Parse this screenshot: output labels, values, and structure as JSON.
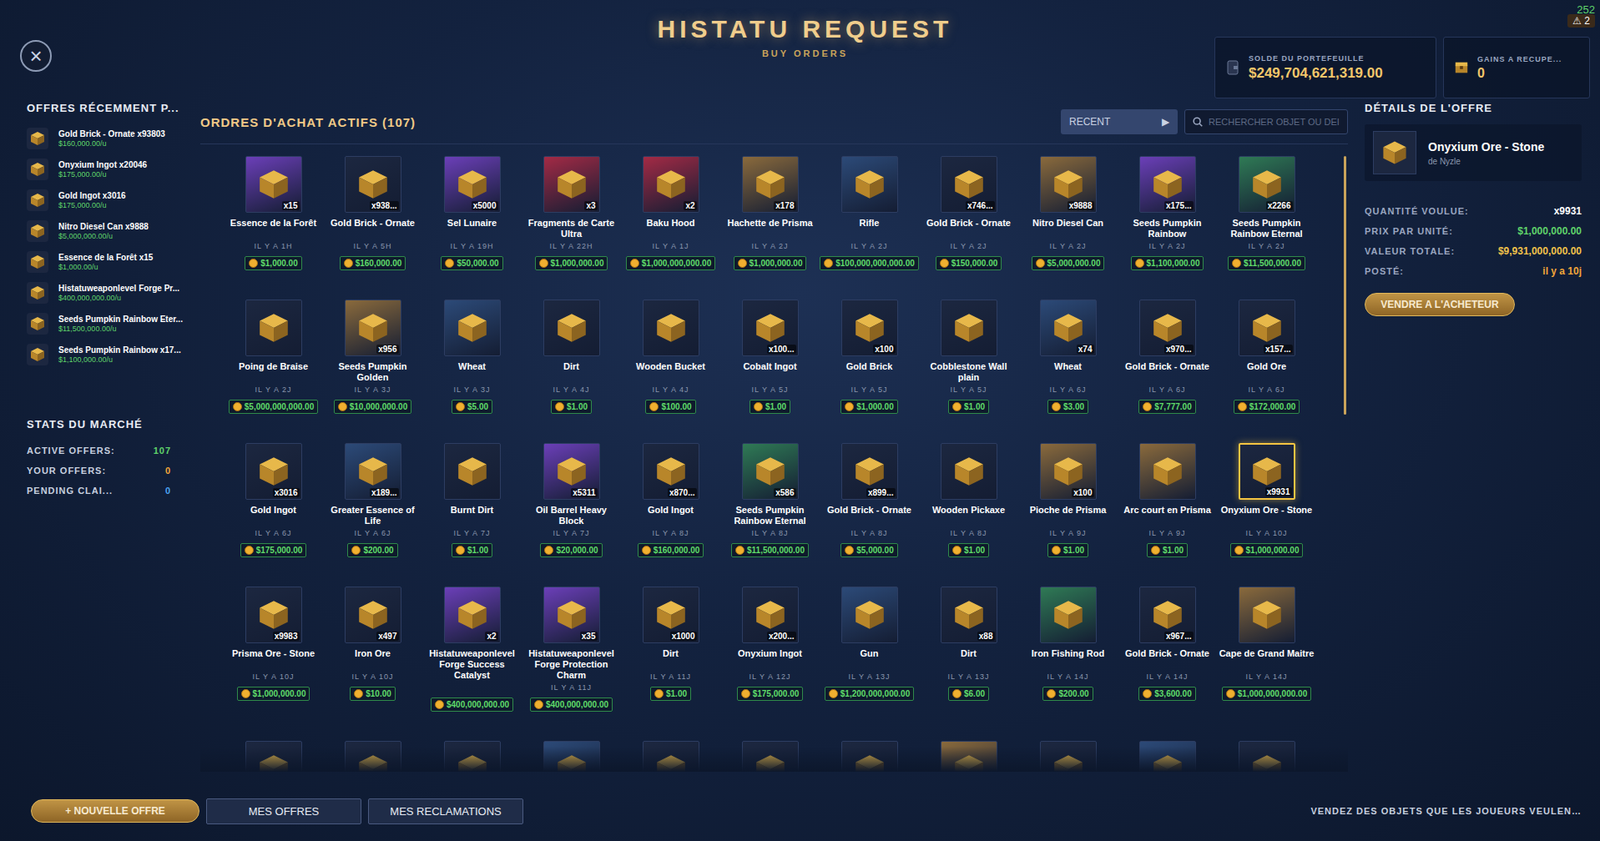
{
  "header": {
    "title": "HISTATU REQUEST",
    "subtitle": "BUY ORDERS",
    "close": "×"
  },
  "wallet": {
    "label": "SOLDE DU PORTEFEUILLE",
    "value": "$249,704,621,319.00"
  },
  "earnings": {
    "label": "GAINS A RECUPE...",
    "value": "0"
  },
  "corner": {
    "counter": "252",
    "alert_icon": "⚠",
    "alert_count": "2"
  },
  "sidebar": {
    "recent_title": "OFFRES RÉCEMMENT P...",
    "recent": [
      {
        "name": "Gold Brick - Ornate x93803",
        "price": "$160,000.00/u"
      },
      {
        "name": "Onyxium Ingot x20046",
        "price": "$175,000.00/u"
      },
      {
        "name": "Gold Ingot x3016",
        "price": "$175,000.00/u"
      },
      {
        "name": "Nitro Diesel Can x9888",
        "price": "$5,000,000.00/u"
      },
      {
        "name": "Essence de la Forêt x15",
        "price": "$1,000.00/u"
      },
      {
        "name": "Histatuweaponlevel Forge Pr...",
        "price": "$400,000,000.00/u"
      },
      {
        "name": "Seeds Pumpkin Rainbow Eter...",
        "price": "$11,500,000.00/u"
      },
      {
        "name": "Seeds Pumpkin Rainbow x17...",
        "price": "$1,100,000.00/u"
      }
    ],
    "stats_title": "STATS DU MARCHÉ",
    "stats": [
      {
        "label": "ACTIVE OFFERS:",
        "value": "107",
        "color": "#5fd36a"
      },
      {
        "label": "YOUR OFFERS:",
        "value": "0",
        "color": "#f0a53a"
      },
      {
        "label": "PENDING CLAI...",
        "value": "0",
        "color": "#4aa3f0"
      }
    ]
  },
  "main": {
    "title": "ORDRES D'ACHAT ACTIFS (107)",
    "sort": {
      "label": "RECENT",
      "icon": "▶"
    },
    "search": {
      "placeholder": "RECHERCHER OBJET OU DEI"
    },
    "cards": [
      {
        "name": "Essence de la Forêt",
        "qty": "x15",
        "time": "IL Y A 1H",
        "price": "$1,000.00",
        "color": "#6b3fb8",
        "selected": false
      },
      {
        "name": "Gold Brick - Ornate",
        "qty": "x938...",
        "time": "IL Y A 5H",
        "price": "$160,000.00",
        "color": "#1c2740",
        "selected": false
      },
      {
        "name": "Sel Lunaire",
        "qty": "x5000",
        "time": "IL Y A 19H",
        "price": "$50,000.00",
        "color": "#6b3fb8",
        "selected": false
      },
      {
        "name": "Fragments de Carte Ultra",
        "qty": "x3",
        "time": "IL Y A 22H",
        "price": "$1,000,000.00",
        "color": "#a32a45",
        "selected": false
      },
      {
        "name": "Baku Hood",
        "qty": "x2",
        "time": "IL Y A 1J",
        "price": "$1,000,000,000.00",
        "color": "#a32a45",
        "selected": false
      },
      {
        "name": "Hachette de Prisma",
        "qty": "x178",
        "time": "IL Y A 2J",
        "price": "$1,000,000.00",
        "color": "#8a6a3c",
        "selected": false
      },
      {
        "name": "Rifle",
        "qty": "",
        "time": "IL Y A 2J",
        "price": "$100,000,000,000.00",
        "color": "#2c4a78",
        "selected": false
      },
      {
        "name": "Gold Brick - Ornate",
        "qty": "x746...",
        "time": "IL Y A 2J",
        "price": "$150,000.00",
        "color": "#1c2740",
        "selected": false
      },
      {
        "name": "Nitro Diesel Can",
        "qty": "x9888",
        "time": "IL Y A 2J",
        "price": "$5,000,000.00",
        "color": "#8a6a3c",
        "selected": false
      },
      {
        "name": "Seeds Pumpkin Rainbow",
        "qty": "x175...",
        "time": "IL Y A 2J",
        "price": "$1,100,000.00",
        "color": "#6b3fb8",
        "selected": false
      },
      {
        "name": "Seeds Pumpkin Rainbow Eternal",
        "qty": "x2266",
        "time": "IL Y A 2J",
        "price": "$11,500,000.00",
        "color": "#2f7a55",
        "selected": false
      },
      {
        "name": "Poing de Braise",
        "qty": "",
        "time": "IL Y A 2J",
        "price": "$5,000,000,000.00",
        "color": "#1c2740",
        "selected": false
      },
      {
        "name": "Seeds Pumpkin Golden",
        "qty": "x956",
        "time": "IL Y A 3J",
        "price": "$10,000,000.00",
        "color": "#8a6a3c",
        "selected": false
      },
      {
        "name": "Wheat",
        "qty": "",
        "time": "IL Y A 3J",
        "price": "$5.00",
        "color": "#2c4a78",
        "selected": false
      },
      {
        "name": "Dirt",
        "qty": "",
        "time": "IL Y A 4J",
        "price": "$1.00",
        "color": "#1c2740",
        "selected": false
      },
      {
        "name": "Wooden Bucket",
        "qty": "",
        "time": "IL Y A 4J",
        "price": "$100.00",
        "color": "#1c2740",
        "selected": false
      },
      {
        "name": "Cobalt Ingot",
        "qty": "x100...",
        "time": "IL Y A 5J",
        "price": "$1.00",
        "color": "#1c2740",
        "selected": false
      },
      {
        "name": "Gold Brick",
        "qty": "x100",
        "time": "IL Y A 5J",
        "price": "$1,000.00",
        "color": "#1c2740",
        "selected": false
      },
      {
        "name": "Cobblestone Wall plain",
        "qty": "",
        "time": "IL Y A 5J",
        "price": "$1.00",
        "color": "#1c2740",
        "selected": false
      },
      {
        "name": "Wheat",
        "qty": "x74",
        "time": "IL Y A 6J",
        "price": "$3.00",
        "color": "#2c4a78",
        "selected": false
      },
      {
        "name": "Gold Brick - Ornate",
        "qty": "x970...",
        "time": "IL Y A 6J",
        "price": "$7,777.00",
        "color": "#1c2740",
        "selected": false
      },
      {
        "name": "Gold Ore",
        "qty": "x157...",
        "time": "IL Y A 6J",
        "price": "$172,000.00",
        "color": "#1c2740",
        "selected": false
      },
      {
        "name": "Gold Ingot",
        "qty": "x3016",
        "time": "IL Y A 6J",
        "price": "$175,000.00",
        "color": "#1c2740",
        "selected": false
      },
      {
        "name": "Greater Essence of Life",
        "qty": "x189...",
        "time": "IL Y A 6J",
        "price": "$200.00",
        "color": "#2c4a78",
        "selected": false
      },
      {
        "name": "Burnt Dirt",
        "qty": "",
        "time": "IL Y A 7J",
        "price": "$1.00",
        "color": "#1c2740",
        "selected": false
      },
      {
        "name": "Oil Barrel Heavy Block",
        "qty": "x5311",
        "time": "IL Y A 7J",
        "price": "$20,000.00",
        "color": "#6b3fb8",
        "selected": false
      },
      {
        "name": "Gold Ingot",
        "qty": "x870...",
        "time": "IL Y A 8J",
        "price": "$160,000.00",
        "color": "#1c2740",
        "selected": false
      },
      {
        "name": "Seeds Pumpkin Rainbow Eternal",
        "qty": "x586",
        "time": "IL Y A 8J",
        "price": "$11,500,000.00",
        "color": "#2f7a55",
        "selected": false
      },
      {
        "name": "Gold Brick - Ornate",
        "qty": "x899...",
        "time": "IL Y A 8J",
        "price": "$5,000.00",
        "color": "#1c2740",
        "selected": false
      },
      {
        "name": "Wooden Pickaxe",
        "qty": "",
        "time": "IL Y A 8J",
        "price": "$1.00",
        "color": "#1c2740",
        "selected": false
      },
      {
        "name": "Pioche de Prisma",
        "qty": "x100",
        "time": "IL Y A 9J",
        "price": "$1.00",
        "color": "#8a6a3c",
        "selected": false
      },
      {
        "name": "Arc court en Prisma",
        "qty": "",
        "time": "IL Y A 9J",
        "price": "$1.00",
        "color": "#8a6a3c",
        "selected": false
      },
      {
        "name": "Onyxium Ore - Stone",
        "qty": "x9931",
        "time": "IL Y A 10J",
        "price": "$1,000,000.00",
        "color": "#1c2740",
        "selected": true
      },
      {
        "name": "Prisma Ore - Stone",
        "qty": "x9983",
        "time": "IL Y A 10J",
        "price": "$1,000,000.00",
        "color": "#1c2740",
        "selected": false
      },
      {
        "name": "Iron Ore",
        "qty": "x497",
        "time": "IL Y A 10J",
        "price": "$10.00",
        "color": "#1c2740",
        "selected": false
      },
      {
        "name": "Histatuweaponlevel Forge Success Catalyst",
        "qty": "x2",
        "time": "",
        "price": "$400,000,000.00",
        "color": "#6b3fb8",
        "selected": false
      },
      {
        "name": "Histatuweaponlevel Forge Protection Charm",
        "qty": "x35",
        "time": "IL Y A 11J",
        "price": "$400,000,000.00",
        "color": "#6b3fb8",
        "selected": false
      },
      {
        "name": "Dirt",
        "qty": "x1000",
        "time": "IL Y A 11J",
        "price": "$1.00",
        "color": "#1c2740",
        "selected": false
      },
      {
        "name": "Onyxium Ingot",
        "qty": "x200...",
        "time": "IL Y A 12J",
        "price": "$175,000.00",
        "color": "#1c2740",
        "selected": false
      },
      {
        "name": "Gun",
        "qty": "",
        "time": "IL Y A 13J",
        "price": "$1,200,000,000.00",
        "color": "#2c4a78",
        "selected": false
      },
      {
        "name": "Dirt",
        "qty": "x88",
        "time": "IL Y A 13J",
        "price": "$6.00",
        "color": "#1c2740",
        "selected": false
      },
      {
        "name": "Iron Fishing Rod",
        "qty": "",
        "time": "IL Y A 14J",
        "price": "$200.00",
        "color": "#2f7a55",
        "selected": false
      },
      {
        "name": "Gold Brick - Ornate",
        "qty": "x967...",
        "time": "IL Y A 14J",
        "price": "$3,600.00",
        "color": "#1c2740",
        "selected": false
      },
      {
        "name": "Cape de Grand Maitre",
        "qty": "",
        "time": "IL Y A 14J",
        "price": "$1,000,000,000.00",
        "color": "#8a6a3c",
        "selected": false
      }
    ],
    "partial_row": [
      {
        "color": "#1c2740"
      },
      {
        "color": "#1c2740"
      },
      {
        "color": "#1c2740"
      },
      {
        "color": "#2c4a78"
      },
      {
        "color": "#1c2740"
      },
      {
        "color": "#1c2740"
      },
      {
        "color": "#1c2740"
      },
      {
        "color": "#8a6a3c"
      },
      {
        "color": "#1c2740"
      },
      {
        "color": "#2c4a78"
      },
      {
        "color": "#1c2740"
      }
    ]
  },
  "details": {
    "title": "DÉTAILS DE L'OFFRE",
    "item": "Onyxium Ore - Stone",
    "seller": "de Nyzle",
    "rows": [
      {
        "label": "QUANTITÉ VOULUE:",
        "value": "x9931",
        "color": "#ffffff"
      },
      {
        "label": "PRIX PAR UNITÉ:",
        "value": "$1,000,000.00",
        "color": "#5fd36a"
      },
      {
        "label": "VALEUR TOTALE:",
        "value": "$9,931,000,000.00",
        "color": "#f0c24a"
      },
      {
        "label": "POSTÉ:",
        "value": "il y a 10j",
        "color": "#f0a53a"
      }
    ],
    "button": "VENDRE A L'ACHETEUR"
  },
  "footer": {
    "new_offer": "+ NOUVELLE OFFRE",
    "tabs": [
      "MES OFFRES",
      "MES RECLAMATIONS"
    ],
    "hint": "VENDEZ DES OBJETS QUE LES JOUEURS VEULEN…"
  }
}
